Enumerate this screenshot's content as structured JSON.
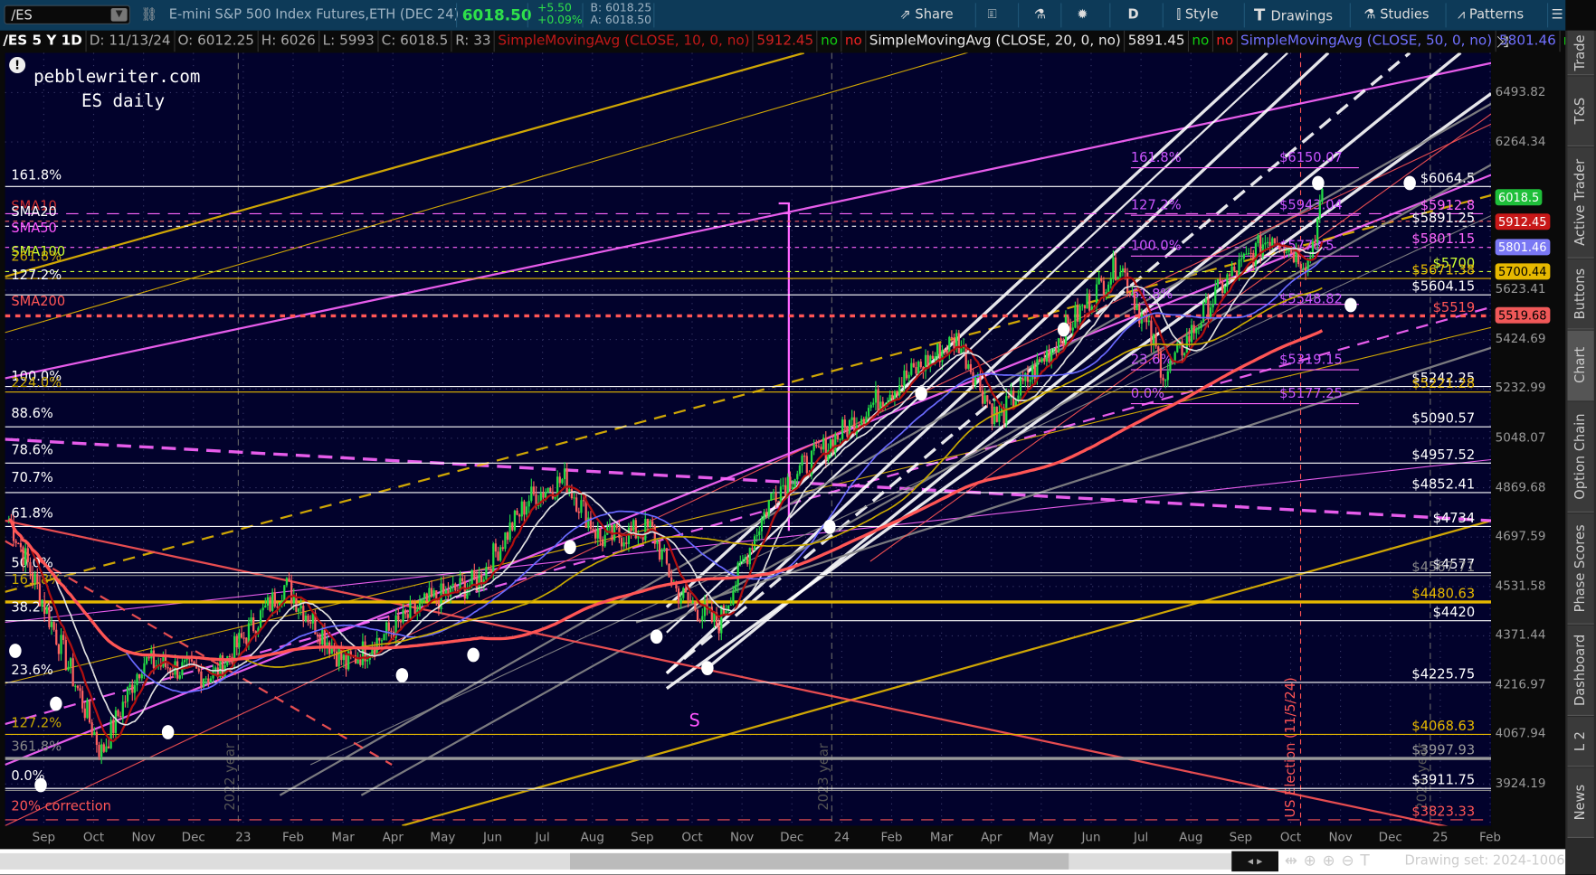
{
  "toolbar": {
    "symbol": "/ES",
    "description": "E-mini S&P 500 Index Futures,ETH (DEC 24)",
    "last": "6018.50",
    "change": "+5.50",
    "change_pct": "+0.09%",
    "bid": "B: 6018.25",
    "ask": "A: 6018.50",
    "share": "Share",
    "period": "D",
    "style": "Style",
    "drawings": "Drawings",
    "studies": "Studies",
    "patterns": "Patterns"
  },
  "info": {
    "chart": "/ES 5 Y 1D",
    "date": "D: 11/13/24",
    "open": "O: 6012.25",
    "high": "H: 6026",
    "low": "L: 5993",
    "close": "C: 6018.5",
    "range": "R: 33",
    "studies": [
      {
        "name": "SimpleMovingAvg (CLOSE, 10, 0, no)",
        "value": "5912.45",
        "color": "#d02020"
      },
      {
        "name": "SimpleMovingAvg (CLOSE, 20, 0, no)",
        "value": "5891.45",
        "color": "#e8e8e8"
      },
      {
        "name": "SimpleMovingAvg (CLOSE, 50, 0, no)",
        "value": "5801.46",
        "color": "#7070ff"
      }
    ],
    "flag_no": "no",
    "more": "..."
  },
  "watermark": {
    "line1": "pebblewriter.com",
    "line2": "ES daily"
  },
  "price_axis": {
    "ticks": [
      "6493.82",
      "6264.34",
      "5623.41",
      "5424.69",
      "5232.99",
      "5048.07",
      "4869.68",
      "4697.59",
      "4531.58",
      "4371.44",
      "4216.97",
      "4067.94",
      "3924.19"
    ],
    "badges": [
      {
        "value": "6018.5",
        "color": "#1fbf3a",
        "text": "#fff"
      },
      {
        "value": "5912.45",
        "color": "#c81818",
        "text": "#fff"
      },
      {
        "value": "5801.46",
        "color": "#7a78f4",
        "text": "#fff"
      },
      {
        "value": "5700.44",
        "color": "#e6b800",
        "text": "#000"
      },
      {
        "value": "5519.68",
        "color": "#f05858",
        "text": "#000"
      }
    ]
  },
  "time_axis": [
    "Sep",
    "Oct",
    "Nov",
    "Dec",
    "23",
    "Feb",
    "Mar",
    "Apr",
    "May",
    "Jun",
    "Jul",
    "Aug",
    "Sep",
    "Oct",
    "Nov",
    "Dec",
    "24",
    "Feb",
    "Mar",
    "Apr",
    "May",
    "Jun",
    "Jul",
    "Aug",
    "Sep",
    "Oct",
    "Nov",
    "Dec",
    "25",
    "Feb"
  ],
  "levels": [
    {
      "price": 6064.5,
      "label": "$6064.5",
      "color": "#ffffff",
      "style": "solid"
    },
    {
      "price": 5945,
      "label": "$5912.8",
      "color": "#ff66ff",
      "style": "dash"
    },
    {
      "price": 5912.45,
      "label": "",
      "color": "#ff6666",
      "style": "dot"
    },
    {
      "price": 5891.25,
      "label": "$5891.25",
      "color": "#ffffff",
      "style": "dot"
    },
    {
      "price": 5801.15,
      "label": "$5801.15",
      "color": "#ff66ff",
      "style": "dot"
    },
    {
      "price": 5700,
      "label": "$5700",
      "color": "#ccff33",
      "style": "dot"
    },
    {
      "price": 5671.38,
      "label": "$5671.38",
      "color": "#e6b800",
      "style": "solid"
    },
    {
      "price": 5604.15,
      "label": "$5604.15",
      "color": "#ffffff",
      "style": "solid"
    },
    {
      "price": 5519,
      "label": "$5519",
      "color": "#ff5555",
      "style": "dotthick"
    },
    {
      "price": 5242.25,
      "label": "$5242.25",
      "color": "#ffffff",
      "style": "solid"
    },
    {
      "price": 5221.28,
      "label": "$5221.28",
      "color": "#e6b800",
      "style": "solid"
    },
    {
      "price": 5090.57,
      "label": "$5090.57",
      "color": "#ffffff",
      "style": "solid"
    },
    {
      "price": 4957.52,
      "label": "$4957.52",
      "color": "#ffffff",
      "style": "solid"
    },
    {
      "price": 4852.41,
      "label": "$4852.41",
      "color": "#ffffff",
      "style": "solid"
    },
    {
      "price": 4734,
      "label": "$4734",
      "color": "#ffffff",
      "style": "solid"
    },
    {
      "price": 4577,
      "label": "$4577",
      "color": "#ffffff",
      "style": "solid"
    },
    {
      "price": 4567.71,
      "label": "$4567.71",
      "color": "#888888",
      "style": "solid"
    },
    {
      "price": 4480.63,
      "label": "$4480.63",
      "color": "#e6b800",
      "style": "thick"
    },
    {
      "price": 4420,
      "label": "$4420",
      "color": "#ffffff",
      "style": "solid"
    },
    {
      "price": 4225.75,
      "label": "$4225.75",
      "color": "#ffffff",
      "style": "solid"
    },
    {
      "price": 4068.63,
      "label": "$4068.63",
      "color": "#e6b800",
      "style": "solid"
    },
    {
      "price": 3997.93,
      "label": "$3997.93",
      "color": "#999999",
      "style": "thick"
    },
    {
      "price": 3911.75,
      "label": "$3911.75",
      "color": "#ffffff",
      "style": "double"
    },
    {
      "price": 3823.33,
      "label": "$3823.33",
      "color": "#ff5555",
      "style": "dash"
    }
  ],
  "left_labels": [
    {
      "price": 6095,
      "text": "161.8%",
      "color": "#ffffff"
    },
    {
      "price": 5960,
      "text": "SMA10",
      "color": "#d03030"
    },
    {
      "price": 5935,
      "text": "SMA20",
      "color": "#ffffff"
    },
    {
      "price": 5865,
      "text": "SMA50",
      "color": "#ff55ff"
    },
    {
      "price": 5765,
      "text": "SMA100",
      "color": "#ccff33"
    },
    {
      "price": 5745,
      "text": "261.8%",
      "color": "#c8a800"
    },
    {
      "price": 5668,
      "text": "127.2%",
      "color": "#ffffff"
    },
    {
      "price": 5560,
      "text": "SMA200",
      "color": "#ff5555"
    },
    {
      "price": 5265,
      "text": "100.0%",
      "color": "#ffffff"
    },
    {
      "price": 5240,
      "text": "224.0%",
      "color": "#c8a800"
    },
    {
      "price": 5125,
      "text": "88.6%",
      "color": "#ffffff"
    },
    {
      "price": 4990,
      "text": "78.6%",
      "color": "#ffffff"
    },
    {
      "price": 4890,
      "text": "70.7%",
      "color": "#ffffff"
    },
    {
      "price": 4765,
      "text": "61.8%",
      "color": "#ffffff"
    },
    {
      "price": 4595,
      "text": "50.0%",
      "color": "#ffffff"
    },
    {
      "price": 4540,
      "text": "161.8%",
      "color": "#c8a800"
    },
    {
      "price": 4450,
      "text": "38.2%",
      "color": "#ffffff"
    },
    {
      "price": 4250,
      "text": "23.6%",
      "color": "#ffffff"
    },
    {
      "price": 4090,
      "text": "127.2%",
      "color": "#c8a800"
    },
    {
      "price": 4020,
      "text": "361.8%",
      "color": "#888888"
    },
    {
      "price": 3935,
      "text": "0.0%",
      "color": "#ffffff"
    },
    {
      "price": 3850,
      "text": "20% correction",
      "color": "#ff5555"
    }
  ],
  "fib_right": [
    {
      "price": 6175,
      "text": "161.8%",
      "color": "#cc55ff"
    },
    {
      "price": 6175,
      "text": "$6150.07",
      "color": "#cc55ff",
      "col": 2
    },
    {
      "price": 5965,
      "text": "127.2%",
      "color": "#cc55ff"
    },
    {
      "price": 5965,
      "text": "$5943.04",
      "color": "#cc55ff",
      "col": 2
    },
    {
      "price": 5790,
      "text": "100.0%",
      "color": "#cc55ff"
    },
    {
      "price": 5790,
      "text": "$5778.5",
      "color": "#cc55ff",
      "col": 2
    },
    {
      "price": 5590,
      "text": "61.8%",
      "color": "#cc55ff"
    },
    {
      "price": 5570,
      "text": "$5548.82",
      "color": "#cc55ff",
      "col": 2
    },
    {
      "price": 5330,
      "text": "23.6%",
      "color": "#cc55ff"
    },
    {
      "price": 5330,
      "text": "$5319.15",
      "color": "#cc55ff",
      "col": 2
    },
    {
      "price": 5200,
      "text": "0.0%",
      "color": "#cc55ff"
    },
    {
      "price": 5200,
      "text": "$5177.25",
      "color": "#cc55ff",
      "col": 2
    }
  ],
  "annotations": {
    "election": "US Election (11/5/24)",
    "y2023": "2023 year",
    "y2022": "2022 year",
    "y2024": "2024 year",
    "s_marker": "S"
  },
  "chart_data": {
    "type": "candlestick",
    "price_scale": "log",
    "ylim": [
      3830,
      6620
    ],
    "price_path": [
      [
        -0.7,
        4760
      ],
      [
        0.05,
        4453
      ],
      [
        1.16,
        4014
      ],
      [
        1.98,
        4292
      ],
      [
        3.41,
        4245
      ],
      [
        4.84,
        4536
      ],
      [
        6.06,
        4280
      ],
      [
        7.69,
        4480
      ],
      [
        8.71,
        4550
      ],
      [
        9.73,
        4831
      ],
      [
        10.45,
        4900
      ],
      [
        11.16,
        4690
      ],
      [
        12.18,
        4725
      ],
      [
        12.69,
        4515
      ],
      [
        13.51,
        4405
      ],
      [
        14.63,
        4853
      ],
      [
        15.45,
        4977
      ],
      [
        16.67,
        5184
      ],
      [
        18.31,
        5428
      ],
      [
        19.12,
        5112
      ],
      [
        20.35,
        5428
      ],
      [
        21.57,
        5737
      ],
      [
        22.49,
        5285
      ],
      [
        23.61,
        5640
      ],
      [
        24.63,
        5857
      ],
      [
        25.35,
        5737
      ],
      [
        25.65,
        6018.5
      ]
    ]
  },
  "statusbar": {
    "drawing_set": "Drawing set: 2024-1006"
  },
  "sidebar": [
    "Trade",
    "T&S",
    "Active Trader",
    "Buttons",
    "Chart",
    "Option Chain",
    "Phase Scores",
    "Dashboard",
    "L 2",
    "News"
  ]
}
